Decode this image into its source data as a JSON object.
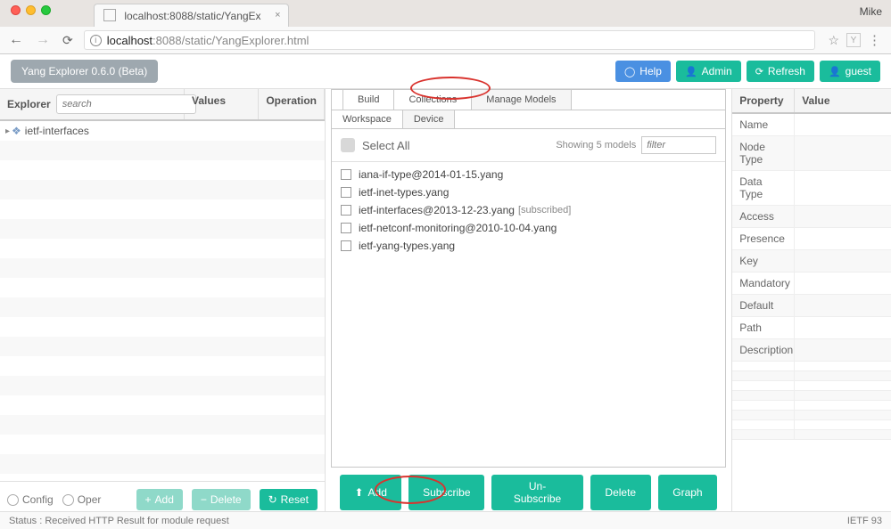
{
  "browser": {
    "tab_title": "localhost:8088/static/YangEx",
    "user": "Mike",
    "url_host": "localhost",
    "url_port": ":8088",
    "url_path": "/static/YangExplorer.html"
  },
  "header": {
    "app_title": "Yang Explorer 0.6.0 (Beta)",
    "buttons": {
      "help": "Help",
      "admin": "Admin",
      "refresh": "Refresh",
      "guest": "guest"
    }
  },
  "left": {
    "cols": {
      "explorer": "Explorer",
      "values": "Values",
      "operation": "Operation"
    },
    "search_placeholder": "search",
    "tree_root": "ietf-interfaces",
    "footer": {
      "config": "Config",
      "oper": "Oper",
      "add": "Add",
      "delete": "Delete",
      "reset": "Reset"
    }
  },
  "center": {
    "tabs_main": [
      "Build",
      "Collections",
      "Manage Models"
    ],
    "tabs_sub": [
      "Workspace",
      "Device"
    ],
    "select_all": "Select All",
    "showing": "Showing 5 models",
    "filter_placeholder": "filter",
    "models": [
      {
        "name": "iana-if-type@2014-01-15.yang",
        "tag": ""
      },
      {
        "name": "ietf-inet-types.yang",
        "tag": ""
      },
      {
        "name": "ietf-interfaces@2013-12-23.yang",
        "tag": "[subscribed]"
      },
      {
        "name": "ietf-netconf-monitoring@2010-10-04.yang",
        "tag": ""
      },
      {
        "name": "ietf-yang-types.yang",
        "tag": ""
      }
    ],
    "footer": {
      "add": "Add",
      "subscribe": "Subscribe",
      "unsubscribe": "Un-Subscribe",
      "delete": "Delete",
      "graph": "Graph"
    }
  },
  "right": {
    "cols": {
      "property": "Property",
      "value": "Value"
    },
    "rows": [
      "Name",
      "Node Type",
      "Data Type",
      "Access",
      "Presence",
      "Key",
      "Mandatory",
      "Default",
      "Path",
      "Description"
    ]
  },
  "status": {
    "text": "Status : Received HTTP Result for module request",
    "right": "IETF 93"
  }
}
